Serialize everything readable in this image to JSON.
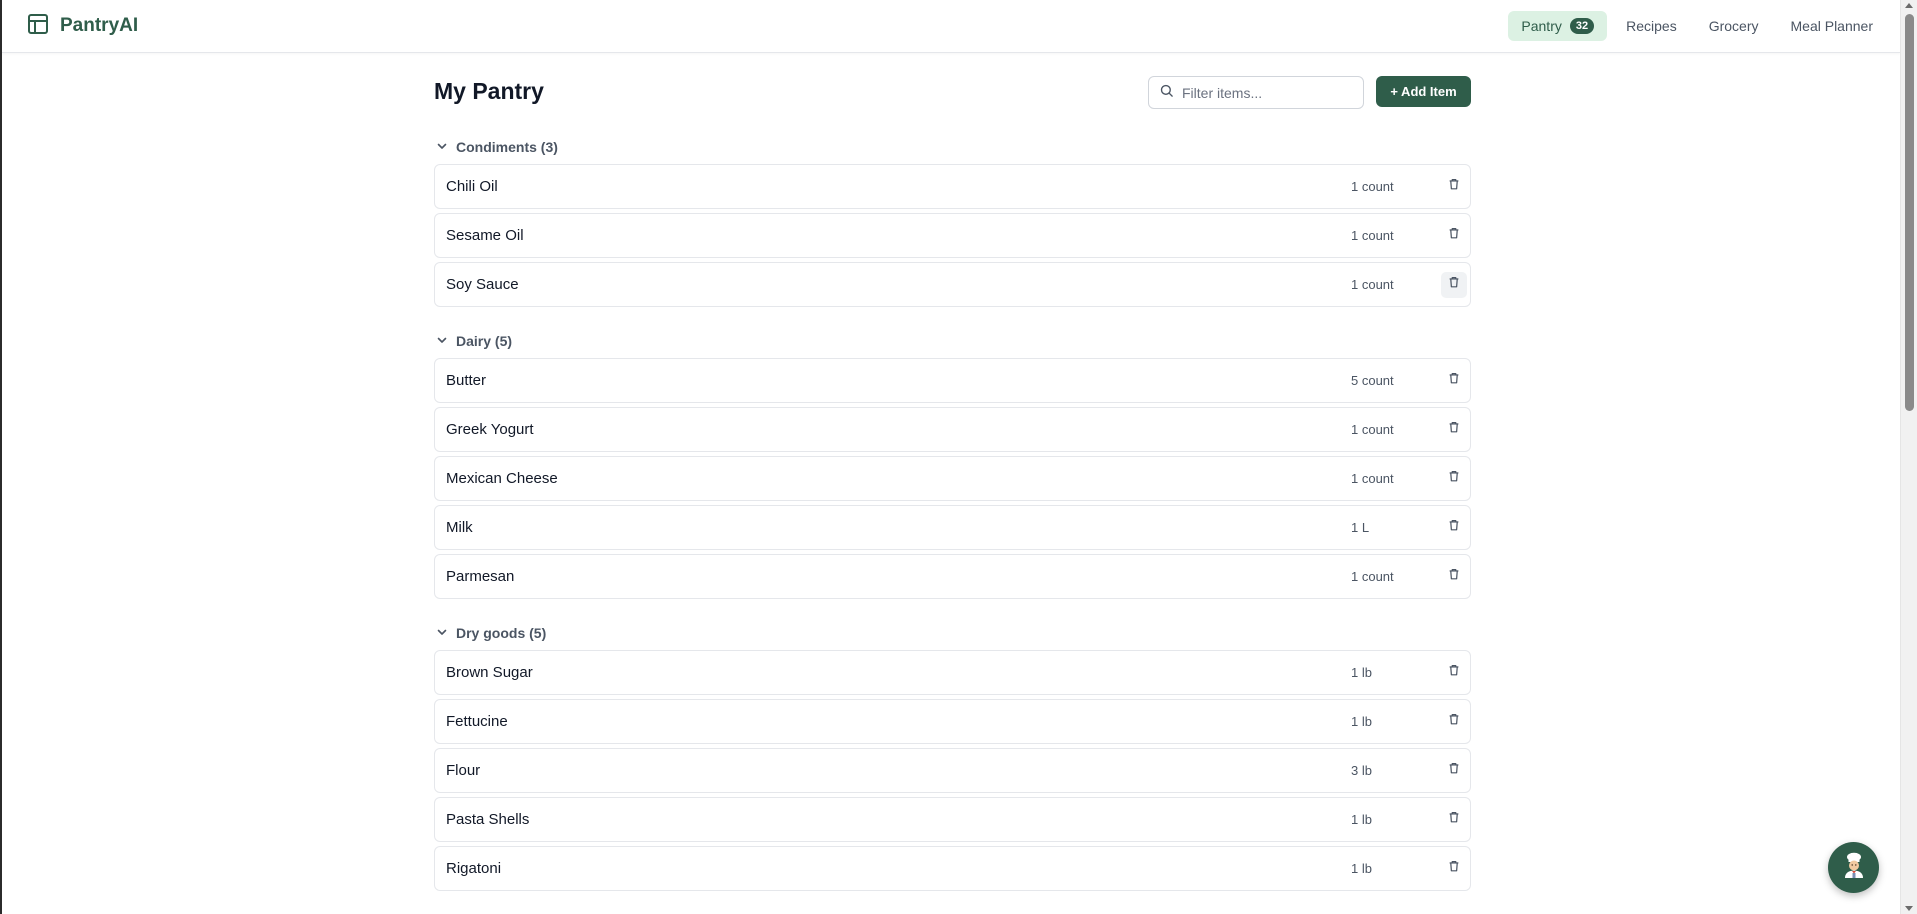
{
  "brand": {
    "name": "PantryAI"
  },
  "nav": [
    {
      "label": "Pantry",
      "badge": "32",
      "active": true
    },
    {
      "label": "Recipes"
    },
    {
      "label": "Grocery"
    },
    {
      "label": "Meal Planner"
    }
  ],
  "page": {
    "title": "My Pantry",
    "filter_placeholder": "Filter items...",
    "add_label": "+ Add Item"
  },
  "categories": [
    {
      "label": "Condiments (3)",
      "items": [
        {
          "name": "Chili Oil",
          "qty": "1 count"
        },
        {
          "name": "Sesame Oil",
          "qty": "1 count"
        },
        {
          "name": "Soy Sauce",
          "qty": "1 count"
        }
      ]
    },
    {
      "label": "Dairy (5)",
      "items": [
        {
          "name": "Butter",
          "qty": "5 count"
        },
        {
          "name": "Greek Yogurt",
          "qty": "1 count"
        },
        {
          "name": "Mexican Cheese",
          "qty": "1 count"
        },
        {
          "name": "Milk",
          "qty": "1 L"
        },
        {
          "name": "Parmesan",
          "qty": "1 count"
        }
      ]
    },
    {
      "label": "Dry goods (5)",
      "items": [
        {
          "name": "Brown Sugar",
          "qty": "1 lb"
        },
        {
          "name": "Fettucine",
          "qty": "1 lb"
        },
        {
          "name": "Flour",
          "qty": "3 lb"
        },
        {
          "name": "Pasta Shells",
          "qty": "1 lb"
        },
        {
          "name": "Rigatoni",
          "qty": "1 lb"
        }
      ]
    }
  ],
  "colors": {
    "brand": "#2f5d4a",
    "active_nav_bg": "#dcf1e3",
    "border": "#e5e7eb"
  },
  "icons": {
    "brand": "layout-icon",
    "search": "search-icon",
    "chevron": "chevron-down-icon",
    "delete": "trash-icon",
    "assistant": "chef-icon"
  }
}
